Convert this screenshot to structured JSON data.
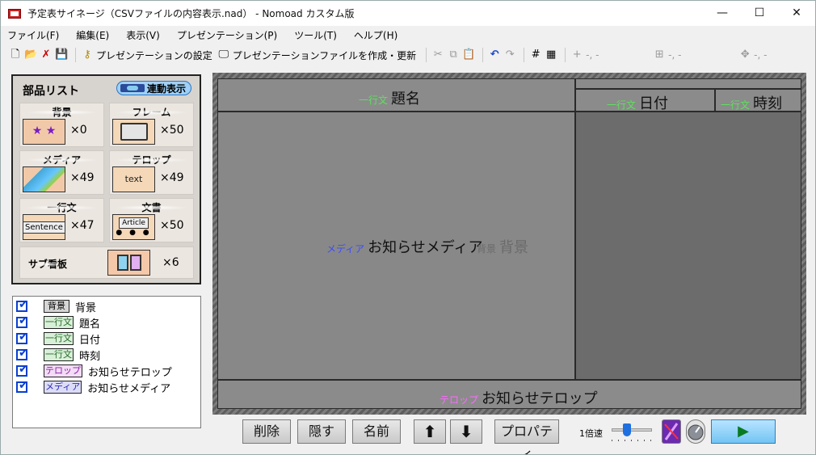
{
  "window": {
    "title": "予定表サイネージ（CSVファイルの内容表示.nad） - Nomoad カスタム版",
    "minimize": "—",
    "maximize": "☐",
    "close": "✕"
  },
  "menu": [
    "ファイル(F)",
    "編集(E)",
    "表示(V)",
    "プレゼンテーション(P)",
    "ツール(T)",
    "ヘルプ(H)"
  ],
  "toolbar": {
    "present_settings": "プレゼンテーションの設定",
    "create_update": "プレゼンテーションファイルを作成・更新",
    "coord1": "-, -",
    "coord2": "-, -",
    "coord3": "-, -"
  },
  "parts": {
    "title": "部品リスト",
    "link_label": "連動表示",
    "items": [
      {
        "name": "背景",
        "count": "×0"
      },
      {
        "name": "フレーム",
        "count": "×50"
      },
      {
        "name": "メディア",
        "count": "×49"
      },
      {
        "name": "テロップ",
        "count": "×49"
      },
      {
        "name": "一行文",
        "count": "×47"
      },
      {
        "name": "文書",
        "count": "×50"
      },
      {
        "name": "サブ看板",
        "count": "×6"
      }
    ],
    "thumb_text": "text",
    "thumb_sentence": "Sentence",
    "thumb_article": "Article",
    "thumb_stars": "★ ★"
  },
  "layers": [
    {
      "tag": "背景",
      "label": "背景"
    },
    {
      "tag": "一行文",
      "label": "題名"
    },
    {
      "tag": "一行文",
      "label": "日付"
    },
    {
      "tag": "一行文",
      "label": "時刻"
    },
    {
      "tag": "テロップ",
      "label": "お知らせテロップ"
    },
    {
      "tag": "メディア",
      "label": "お知らせメディア"
    }
  ],
  "stage": {
    "title": {
      "kind": "一行文",
      "value": "題名"
    },
    "date": {
      "kind": "一行文",
      "value": "日付"
    },
    "time": {
      "kind": "一行文",
      "value": "時刻"
    },
    "media": {
      "kind": "メディア",
      "value": "お知らせメディア"
    },
    "bg": {
      "kind": "背景",
      "value": "背景"
    },
    "telop": {
      "kind": "テロップ",
      "value": "お知らせテロップ"
    }
  },
  "bottom": {
    "delete": "削除",
    "hide": "隠す",
    "name": "名前",
    "up": "⬆",
    "down": "⬇",
    "properties": "プロパティ",
    "speed": "1倍速",
    "play": "▶"
  }
}
